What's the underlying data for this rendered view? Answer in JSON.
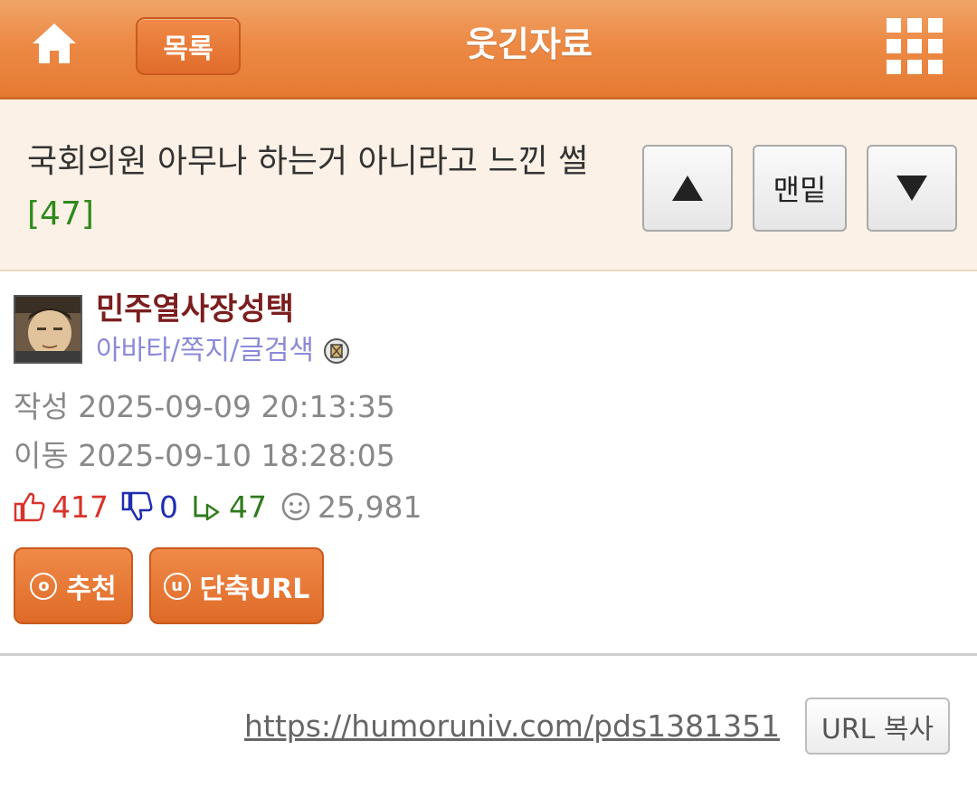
{
  "header": {
    "list_label": "목록",
    "title": "웃긴자료",
    "home_icon": "home-icon",
    "menu_icon": "grid-menu-icon"
  },
  "post": {
    "title": "국회의원 아무나 하는거 아니라고 느낀 썰",
    "comment_count": "[47]"
  },
  "nav": {
    "bottom_label": "맨밑",
    "up_icon": "triangle-up-icon",
    "down_icon": "triangle-down-icon"
  },
  "author": {
    "name": "민주열사장성택",
    "links": "아바타/쪽지/글검색"
  },
  "meta": {
    "created": "작성 2025-09-09 20:13:35",
    "moved": "이동 2025-09-10 18:28:05"
  },
  "stats": {
    "likes": "417",
    "dislikes": "0",
    "replies": "47",
    "views": "25,981"
  },
  "actions": {
    "recommend_label": "추천",
    "recommend_glyph": "o",
    "shorturl_label": "단축URL",
    "shorturl_glyph": "u"
  },
  "share": {
    "url": "https://humoruniv.com/pds1381351",
    "copy_label": "URL 복사"
  },
  "colors": {
    "header_orange": "#e67a33",
    "title_band": "#fbf1e6",
    "comment_green": "#2f8a1c",
    "author_red": "#7b1e1e",
    "link_purple": "#8a8ad8",
    "like_red": "#d8332a",
    "dislike_blue": "#1e2db0"
  }
}
